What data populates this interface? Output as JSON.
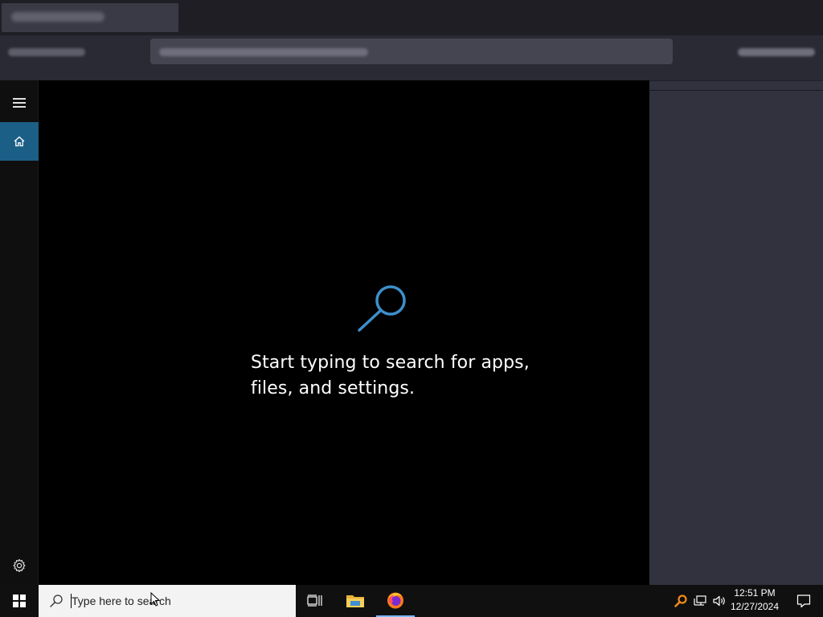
{
  "search_panel": {
    "empty_state_line1": "Start typing to search for apps,",
    "empty_state_line2": "files, and settings.",
    "rail": {
      "menu_icon": "hamburger-icon",
      "home_icon": "home-icon",
      "settings_icon": "gear-icon"
    },
    "accent_color": "#1c5f86",
    "glyph_color": "#3d8fcb"
  },
  "taskbar": {
    "search_placeholder": "Type here to search",
    "pinned": [
      {
        "name": "Task View",
        "icon": "task-view-icon"
      },
      {
        "name": "File Explorer",
        "icon": "folder-icon"
      },
      {
        "name": "Firefox",
        "icon": "firefox-icon"
      }
    ],
    "tray": {
      "icons": [
        "search-tool-icon",
        "network-icon",
        "volume-icon"
      ],
      "time": "12:51 PM",
      "date": "12/27/2024",
      "notification_icon": "notification-icon"
    }
  }
}
